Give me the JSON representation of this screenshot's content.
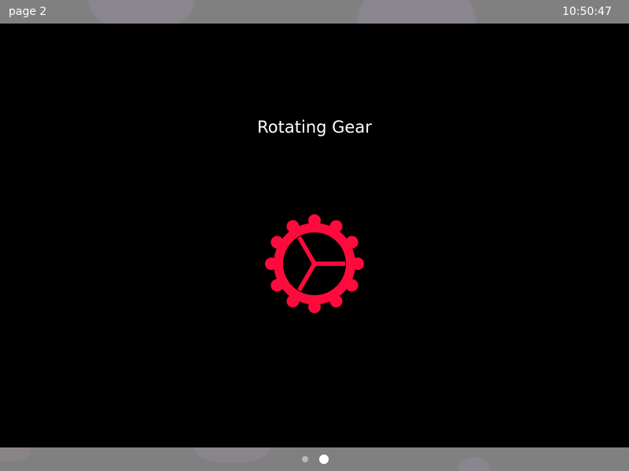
{
  "status_bar": {
    "page_label": "page 2",
    "clock": "10:50:47"
  },
  "main": {
    "title": "Rotating Gear",
    "gear_icon": "gear-icon",
    "gear_color": "#ff0a3c"
  },
  "pager": {
    "total_pages": 2,
    "current_page": 2,
    "dot_inactive_color": "#b8b8b8",
    "dot_active_color": "#ffffff"
  },
  "colors": {
    "background": "#000000",
    "bar_background": "#808080",
    "text": "#ffffff"
  }
}
